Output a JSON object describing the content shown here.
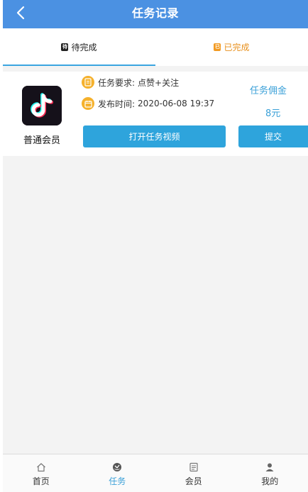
{
  "header": {
    "title": "任务记录",
    "back_icon": "chevron-left-icon"
  },
  "tabs": [
    {
      "label": "待完成",
      "badge": "待",
      "icon": "pending-icon",
      "active": true
    },
    {
      "label": "已完成",
      "badge": "已",
      "icon": "done-icon",
      "active": false
    }
  ],
  "task": {
    "app_icon": "tiktok-logo",
    "member_label": "普通会员",
    "requirement_label": "任务要求:",
    "requirement_value": "点赞+关注",
    "time_label": "发布时间:",
    "time_value": "2020-06-08 19:37",
    "commission_label": "任务佣金",
    "commission_value": "8元",
    "open_button": "打开任务视频",
    "submit_button": "提交"
  },
  "bottom_nav": [
    {
      "label": "首页",
      "icon": "home-icon",
      "active": false
    },
    {
      "label": "任务",
      "icon": "task-icon",
      "active": true
    },
    {
      "label": "会员",
      "icon": "member-card-icon",
      "active": false
    },
    {
      "label": "我的",
      "icon": "user-icon",
      "active": false
    }
  ],
  "colors": {
    "header_bg": "#4b91e2",
    "accent": "#2ea4dc",
    "done_tab": "#e8901c",
    "info_icon": "#f5b12c"
  }
}
